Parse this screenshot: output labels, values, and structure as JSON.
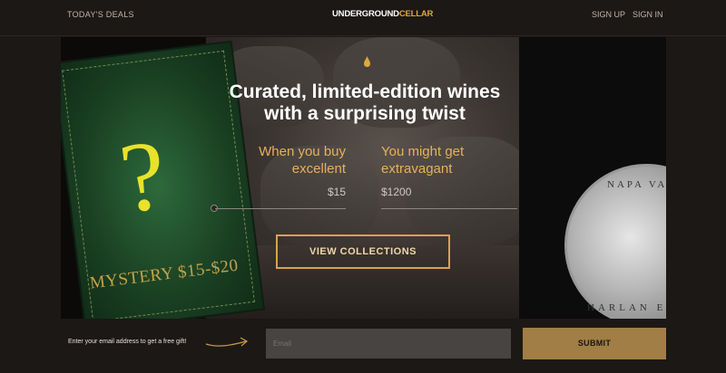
{
  "header": {
    "deals_label": "TODAY'S DEALS",
    "logo_part1": "UNDERGROUND",
    "logo_part2": "CELLAR",
    "signup_label": "SIGN UP",
    "signin_label": "SIGN IN"
  },
  "hero": {
    "headline_line1": "Curated, limited-edition wines",
    "headline_line2": "with a surprising twist",
    "left_col": {
      "line1": "When you buy",
      "line2": "excellent",
      "price": "$15"
    },
    "right_col": {
      "line1": "You might get",
      "line2": "extravagant",
      "price": "$1200"
    },
    "cta_label": "VIEW COLLECTIONS",
    "mystery_label": "MYSTERY $15-$20",
    "coin_text_top": "NAPA VAL",
    "coin_text_bottom": "HARLAN EST"
  },
  "footer": {
    "prompt": "Enter your email address to get a free gift!",
    "email_placeholder": "Email",
    "submit_label": "SUBMIT"
  },
  "colors": {
    "accent": "#e0a83a",
    "background": "#1c1816",
    "submit_bg": "#a17e45"
  }
}
